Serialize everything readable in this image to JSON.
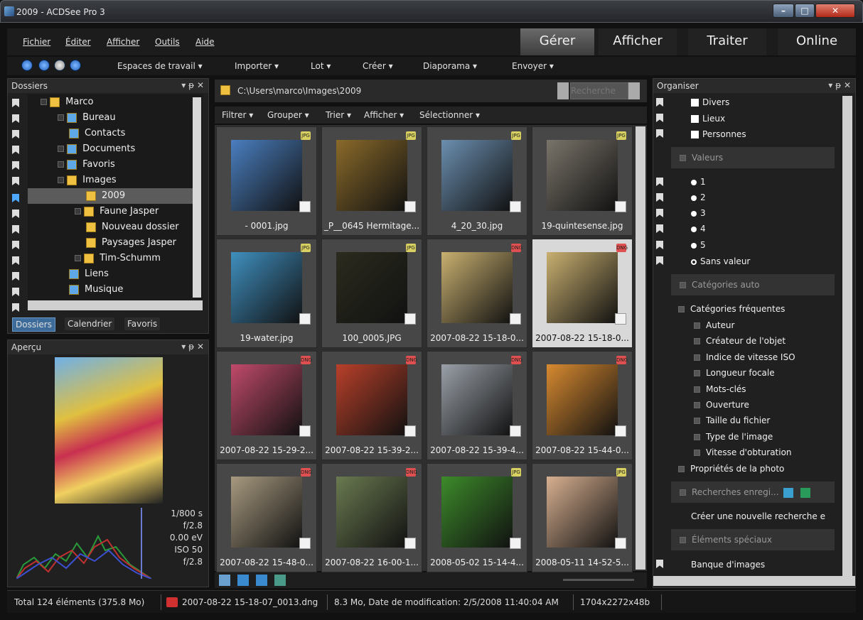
{
  "window": {
    "title": "2009 - ACDSee Pro 3",
    "min": "–",
    "max": "□",
    "close": "✕"
  },
  "menu": [
    "Fichier",
    "Éditer",
    "Afficher",
    "Outils",
    "Aide"
  ],
  "modes": [
    "Gérer",
    "Afficher",
    "Traiter",
    "Online"
  ],
  "toolbar": [
    "Espaces de travail ▾",
    "Importer ▾",
    "Lot ▾",
    "Créer ▾",
    "Diaporama ▾",
    "Envoyer ▾"
  ],
  "folders": {
    "title": "Dossiers",
    "items": [
      "Marco",
      "Bureau",
      "Contacts",
      "Documents",
      "Favoris",
      "Images",
      "2009",
      "Faune Jasper",
      "Nouveau dossier",
      "Paysages Jasper",
      "Tim-Schumm",
      "Liens",
      "Musique"
    ],
    "tabs": [
      "Dossiers",
      "Calendrier",
      "Favoris"
    ]
  },
  "preview": {
    "title": "Aperçu",
    "shutter": "1/800 s",
    "aperture": "f/2.8",
    "ev": "0.00 eV",
    "iso": "ISO 50",
    "fnum": "f/2.8"
  },
  "path": {
    "value": "C:\\Users\\marco\\Images\\2009",
    "search_placeholder": "Recherche"
  },
  "filterbar": [
    "Filtrer ▾",
    "Grouper ▾",
    "Trier ▾",
    "Afficher ▾",
    "Sélectionner ▾"
  ],
  "thumbs": [
    {
      "cap": "- 0001.jpg",
      "fmt": "JPG",
      "c": "#4a7fc0"
    },
    {
      "cap": "_P__0645 Hermitage...",
      "fmt": "JPG",
      "c": "#8a6a2a"
    },
    {
      "cap": "4_20_30.jpg",
      "fmt": "JPG",
      "c": "#6b8fb0"
    },
    {
      "cap": "19-quintesense.jpg",
      "fmt": "JPG",
      "c": "#7a746a"
    },
    {
      "cap": "19-water.jpg",
      "fmt": "JPG",
      "c": "#3f8fbf"
    },
    {
      "cap": "100_0005.JPG",
      "fmt": "JPG",
      "c": "#2b2b1e"
    },
    {
      "cap": "2007-08-22 15-18-0...",
      "fmt": "DNG",
      "c": "#c9b070"
    },
    {
      "cap": "2007-08-22 15-18-0...",
      "fmt": "DNG",
      "c": "#c9b070"
    },
    {
      "cap": "2007-08-22 15-29-2...",
      "fmt": "DNG",
      "c": "#c04a6a"
    },
    {
      "cap": "2007-08-22 15-39-2...",
      "fmt": "DNG",
      "c": "#b8402a"
    },
    {
      "cap": "2007-08-22 15-39-4...",
      "fmt": "DNG",
      "c": "#9aa0a8"
    },
    {
      "cap": "2007-08-22 15-44-0...",
      "fmt": "DNG",
      "c": "#d88a30"
    },
    {
      "cap": "2007-08-22 15-48-0...",
      "fmt": "DNG",
      "c": "#a89a80"
    },
    {
      "cap": "2007-08-22 16-00-1...",
      "fmt": "DNG",
      "c": "#6a7a50"
    },
    {
      "cap": "2008-05-02 15-14-4...",
      "fmt": "JPG",
      "c": "#3c8a2a"
    },
    {
      "cap": "2008-05-11 14-52-5...",
      "fmt": "JPG",
      "c": "#d8b090"
    }
  ],
  "organiser": {
    "title": "Organiser",
    "cats": [
      "Divers",
      "Lieux",
      "Personnes"
    ],
    "valeurs_title": "Valeurs",
    "ratings": [
      "1",
      "2",
      "3",
      "4",
      "5",
      "Sans valeur"
    ],
    "auto_title": "Catégories auto",
    "freq_title": "Catégories fréquentes",
    "freq_items": [
      "Auteur",
      "Créateur de l'objet",
      "Indice de vitesse ISO",
      "Longueur focale",
      "Mots-clés",
      "Ouverture",
      "Taille du fichier",
      "Type de l'image",
      "Vitesse d'obturation"
    ],
    "photo_props": "Propriétés de la photo",
    "saved_title": "Recherches enregi...",
    "new_search": "Créer une nouvelle recherche e",
    "special_title": "Éléments spéciaux",
    "image_bank": "Banque d'images"
  },
  "status": {
    "total": "Total 124 éléments  (375.8 Mo)",
    "file": "2007-08-22 15-18-07_0013.dng",
    "info": "8.3 Mo, Date de modification: 2/5/2008 11:40:04 AM",
    "dims": "1704x2272x48b"
  }
}
